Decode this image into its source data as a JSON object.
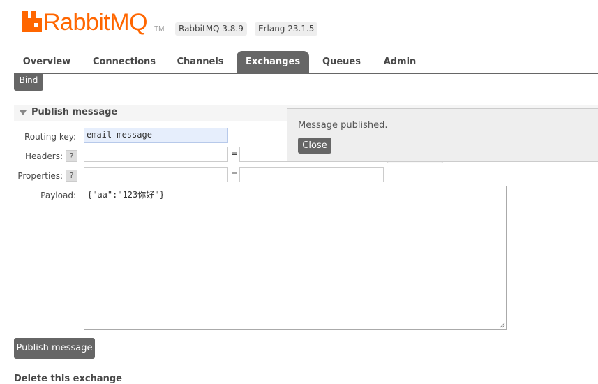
{
  "header": {
    "logo_text": "RabbitMQ",
    "logo_tm": "TM",
    "version_label": "RabbitMQ 3.8.9",
    "erlang_label": "Erlang 23.1.5"
  },
  "nav": {
    "tabs": [
      {
        "label": "Overview",
        "active": false
      },
      {
        "label": "Connections",
        "active": false
      },
      {
        "label": "Channels",
        "active": false
      },
      {
        "label": "Exchanges",
        "active": true
      },
      {
        "label": "Queues",
        "active": false
      },
      {
        "label": "Admin",
        "active": false
      }
    ]
  },
  "bind_button": "Bind",
  "publish": {
    "section_title": "Publish message",
    "routing_key_label": "Routing key:",
    "routing_key_value": "email-message",
    "headers_label": "Headers:",
    "properties_label": "Properties:",
    "payload_label": "Payload:",
    "payload_value": "{\"aa\":\"123你好\"}",
    "help_glyph": "?",
    "equals": "=",
    "submit_label": "Publish message"
  },
  "toast": {
    "message": "Message published.",
    "close_label": "Close"
  },
  "next_section_title": "Delete this exchange",
  "colors": {
    "brand": "#ff6600",
    "tab_active": "#666666",
    "button": "#666666",
    "highlight_field": "#e6eefc"
  }
}
